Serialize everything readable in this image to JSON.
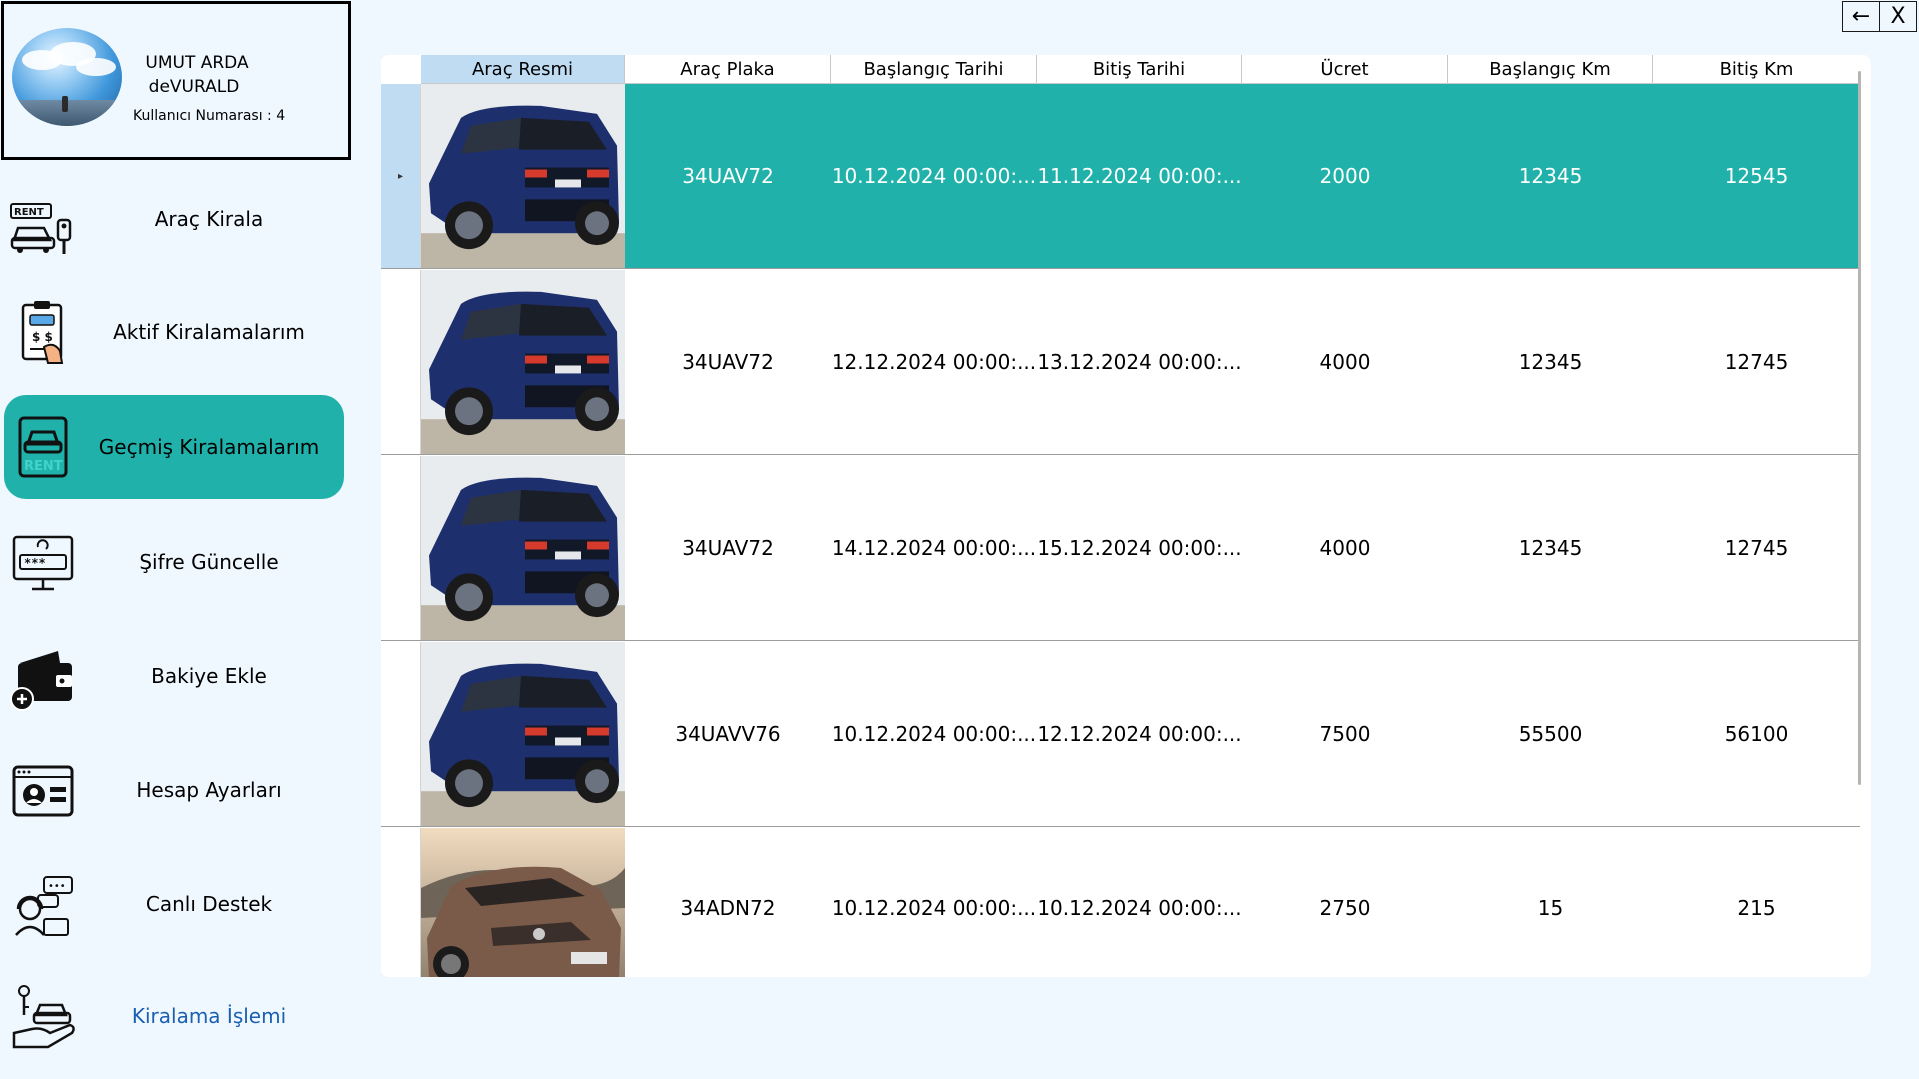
{
  "user": {
    "name_line1": "UMUT ARDA",
    "name_line2": "deVURALD",
    "id_label": "Kullanıcı Numarası :",
    "id_value": "4"
  },
  "sidebar": {
    "items": [
      {
        "label": "Araç Kirala",
        "icon": "rent-car-key-icon"
      },
      {
        "label": "Aktif Kiralamalarım",
        "icon": "rental-document-icon"
      },
      {
        "label": "Geçmiş Kiralamalarım",
        "icon": "rent-history-icon"
      },
      {
        "label": "Şifre Güncelle",
        "icon": "password-monitor-icon"
      },
      {
        "label": "Bakiye Ekle",
        "icon": "wallet-add-icon"
      },
      {
        "label": "Hesap Ayarları",
        "icon": "id-card-icon"
      },
      {
        "label": "Canlı Destek",
        "icon": "live-support-icon"
      },
      {
        "label": "Kiralama İşlemi",
        "icon": "hand-car-key-icon"
      }
    ],
    "active_index": 2,
    "accent_color": "#20b2aa"
  },
  "window": {
    "back_label": "←",
    "close_label": "X"
  },
  "table": {
    "columns": [
      "Araç Resmi",
      "Araç Plaka",
      "Başlangıç Tarihi",
      "Bitiş Tarihi",
      "Ücret",
      "Başlangıç Km",
      "Bitiş Km"
    ],
    "rows": [
      {
        "car_image": "bmw-x5-blue",
        "plate": "34UAV72",
        "start": "10.12.2024 00:00:...",
        "end": "11.12.2024 00:00:...",
        "fee": "2000",
        "start_km": "12345",
        "end_km": "12545"
      },
      {
        "car_image": "bmw-x5-blue",
        "plate": "34UAV72",
        "start": "12.12.2024 00:00:...",
        "end": "13.12.2024 00:00:...",
        "fee": "4000",
        "start_km": "12345",
        "end_km": "12745"
      },
      {
        "car_image": "bmw-x5-blue",
        "plate": "34UAV72",
        "start": "14.12.2024 00:00:...",
        "end": "15.12.2024 00:00:...",
        "fee": "4000",
        "start_km": "12345",
        "end_km": "12745"
      },
      {
        "car_image": "bmw-x5-blue",
        "plate": "34UAVV76",
        "start": "10.12.2024 00:00:...",
        "end": "12.12.2024 00:00:...",
        "fee": "7500",
        "start_km": "55500",
        "end_km": "56100"
      },
      {
        "car_image": "renault-megane-bronze",
        "plate": "34ADN72",
        "start": "10.12.2024 00:00:...",
        "end": "10.12.2024 00:00:...",
        "fee": "2750",
        "start_km": "15",
        "end_km": "215"
      }
    ],
    "selected_row": 0,
    "row_marker": "▸",
    "selection_color": "#20b2aa",
    "header_selected_color": "#bfdcf3"
  }
}
